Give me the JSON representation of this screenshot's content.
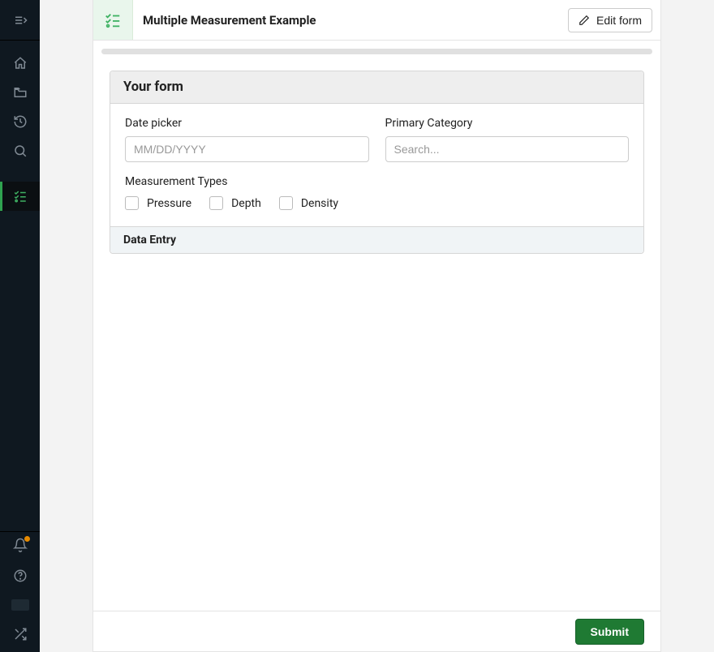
{
  "header": {
    "title": "Multiple Measurement Example",
    "edit_button": "Edit form"
  },
  "form": {
    "panel_title": "Your form",
    "date_picker": {
      "label": "Date picker",
      "placeholder": "MM/DD/YYYY",
      "value": ""
    },
    "primary_category": {
      "label": "Primary Category",
      "placeholder": "Search...",
      "value": ""
    },
    "measurement_types": {
      "label": "Measurement Types",
      "options": [
        "Pressure",
        "Depth",
        "Density"
      ]
    },
    "data_entry_label": "Data Entry"
  },
  "footer": {
    "submit": "Submit"
  },
  "colors": {
    "accent": "#3fb263",
    "submit": "#1f7a33"
  }
}
